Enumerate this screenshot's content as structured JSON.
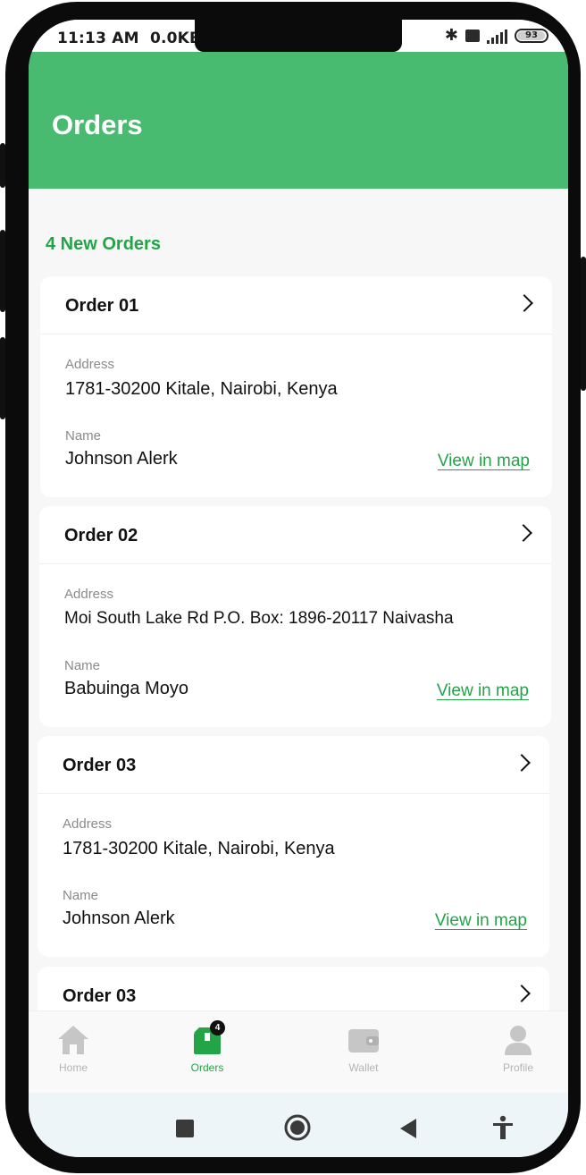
{
  "status_bar": {
    "time": "11:13 AM",
    "net_speed": "0.0KB/",
    "battery": "93"
  },
  "header": {
    "title": "Orders"
  },
  "summary": {
    "count_label": "4 New Orders"
  },
  "orders": [
    {
      "title": "Order 01",
      "address_label": "Address",
      "address": "1781-30200 Kitale, Nairobi, Kenya",
      "name_label": "Name",
      "name": "Johnson Alerk",
      "map_link": "View in map"
    },
    {
      "title": "Order 02",
      "address_label": "Address",
      "address": "Moi South Lake Rd P.O. Box: 1896-20117 Naivasha",
      "name_label": "Name",
      "name": "Babuinga Moyo",
      "map_link": "View in map"
    },
    {
      "title": "Order 03",
      "address_label": "Address",
      "address": "1781-30200 Kitale, Nairobi, Kenya",
      "name_label": "Name",
      "name": "Johnson Alerk",
      "map_link": "View in map"
    },
    {
      "title": "Order 03"
    }
  ],
  "nav": {
    "items": [
      {
        "label": "Home",
        "icon": "home-icon"
      },
      {
        "label": "Orders",
        "icon": "orders-icon",
        "badge": "4"
      },
      {
        "label": "Wallet",
        "icon": "wallet-icon"
      },
      {
        "label": "Profile",
        "icon": "profile-icon"
      }
    ],
    "active_color": "#22a447",
    "inactive_color": "#b4b4b4"
  },
  "colors": {
    "header_bg": "#48bb70",
    "accent": "#22a447"
  }
}
